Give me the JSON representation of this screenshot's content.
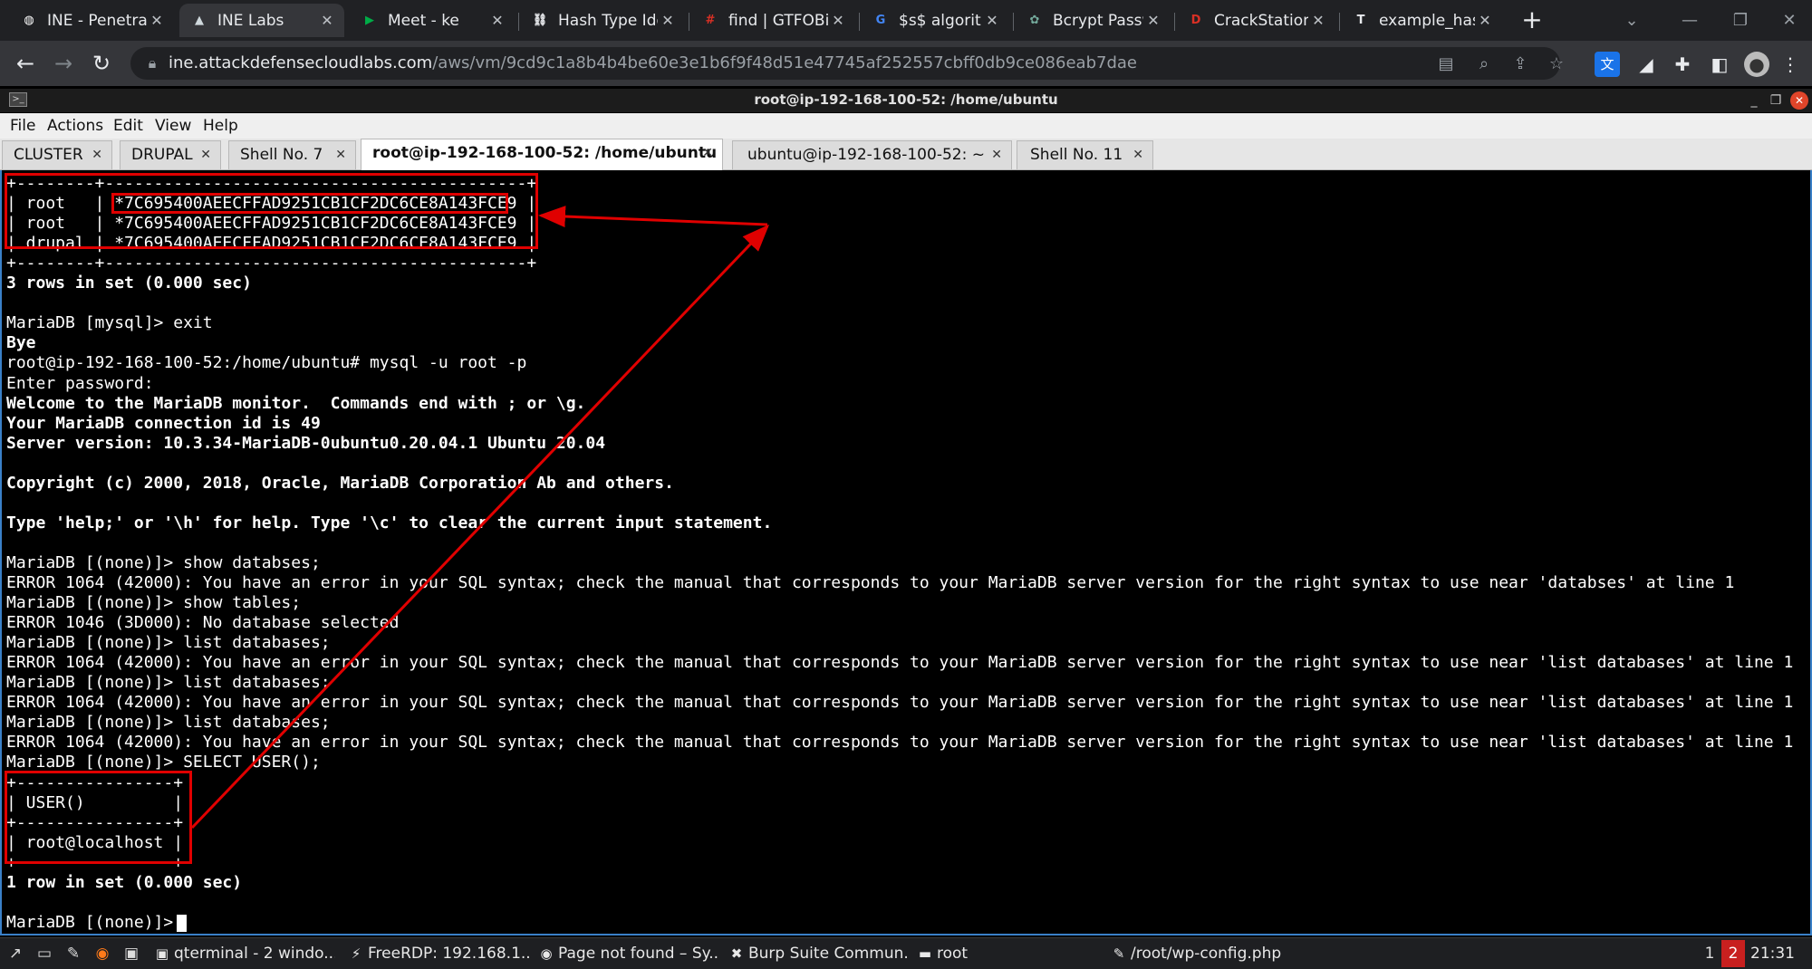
{
  "browser": {
    "tabs": [
      {
        "title": "INE - Penetrati",
        "icon": "ine-icon",
        "icon_color": "#ffffff",
        "glyph": "◍"
      },
      {
        "title": "INE Labs",
        "icon": "ine-labs-icon",
        "icon_color": "#cfd8dc",
        "glyph": "▲"
      },
      {
        "title": "Meet - ke",
        "icon": "google-meet-icon",
        "icon_color": "#00ac47",
        "glyph": "▶"
      },
      {
        "title": "Hash Type Ide",
        "icon": "hash-type-icon",
        "icon_color": "#e8eaed",
        "glyph": "⛓"
      },
      {
        "title": "find | GTFOBin",
        "icon": "gtfobins-icon",
        "icon_color": "#d93025",
        "glyph": "#"
      },
      {
        "title": "$s$ algorithm",
        "icon": "google-icon",
        "icon_color": "#4285f4",
        "glyph": "G"
      },
      {
        "title": "Bcrypt Passwo",
        "icon": "chatgpt-icon",
        "icon_color": "#74aa9c",
        "glyph": "✿"
      },
      {
        "title": "CrackStation -",
        "icon": "crackstation-icon",
        "icon_color": "#d93025",
        "glyph": "D"
      },
      {
        "title": "example_hash",
        "icon": "hashcat-icon",
        "icon_color": "#e8eaed",
        "glyph": "T"
      }
    ],
    "url_host": "ine.attackdefensecloudlabs.com",
    "url_path": "/aws/vm/9cd9c1a8b4b4be60e3e1b6f9f48d51e47745af252557cbff0db9ce086eab7dae"
  },
  "window": {
    "title": "root@ip-192-168-100-52: /home/ubuntu"
  },
  "menu": [
    "File",
    "Actions",
    "Edit",
    "View",
    "Help"
  ],
  "terminal_tabs": [
    {
      "label": "CLUSTER"
    },
    {
      "label": "DRUPAL"
    },
    {
      "label": "Shell No. 7"
    },
    {
      "label": "root@ip-192-168-100-52: /home/ubuntu"
    },
    {
      "label": "ubuntu@ip-192-168-100-52: ~"
    },
    {
      "label": "Shell No. 11"
    }
  ],
  "terminal": {
    "lines": [
      {
        "text": "+--------+-------------------------------------------+",
        "bold": false
      },
      {
        "text": "| root   | *7C695400AEECFFAD9251CB1CF2DC6CE8A143FCE9 |",
        "bold": false
      },
      {
        "text": "| root   | *7C695400AEECFFAD9251CB1CF2DC6CE8A143FCE9 |",
        "bold": false
      },
      {
        "text": "| drupal | *7C695400AEECFFAD9251CB1CF2DC6CE8A143FCE9 |",
        "bold": false
      },
      {
        "text": "+--------+-------------------------------------------+",
        "bold": false
      },
      {
        "text": "3 rows in set (0.000 sec)",
        "bold": true
      },
      {
        "text": "",
        "bold": false
      },
      {
        "text": "MariaDB [mysql]> exit",
        "bold": false
      },
      {
        "text": "Bye",
        "bold": true
      },
      {
        "text": "root@ip-192-168-100-52:/home/ubuntu# mysql -u root -p",
        "bold": false
      },
      {
        "text": "Enter password:",
        "bold": false
      },
      {
        "text": "Welcome to the MariaDB monitor.  Commands end with ; or \\g.",
        "bold": true
      },
      {
        "text": "Your MariaDB connection id is 49",
        "bold": true
      },
      {
        "text": "Server version: 10.3.34-MariaDB-0ubuntu0.20.04.1 Ubuntu 20.04",
        "bold": true
      },
      {
        "text": "",
        "bold": false
      },
      {
        "text": "Copyright (c) 2000, 2018, Oracle, MariaDB Corporation Ab and others.",
        "bold": true
      },
      {
        "text": "",
        "bold": false
      },
      {
        "text": "Type 'help;' or '\\h' for help. Type '\\c' to clear the current input statement.",
        "bold": true
      },
      {
        "text": "",
        "bold": false
      },
      {
        "text": "MariaDB [(none)]> show databses;",
        "bold": false
      },
      {
        "text": "ERROR 1064 (42000): You have an error in your SQL syntax; check the manual that corresponds to your MariaDB server version for the right syntax to use near 'databses' at line 1",
        "bold": false
      },
      {
        "text": "MariaDB [(none)]> show tables;",
        "bold": false
      },
      {
        "text": "ERROR 1046 (3D000): No database selected",
        "bold": false
      },
      {
        "text": "MariaDB [(none)]> list databases;",
        "bold": false
      },
      {
        "text": "ERROR 1064 (42000): You have an error in your SQL syntax; check the manual that corresponds to your MariaDB server version for the right syntax to use near 'list databases' at line 1",
        "bold": false
      },
      {
        "text": "MariaDB [(none)]> list databases;",
        "bold": false
      },
      {
        "text": "ERROR 1064 (42000): You have an error in your SQL syntax; check the manual that corresponds to your MariaDB server version for the right syntax to use near 'list databases' at line 1",
        "bold": false
      },
      {
        "text": "MariaDB [(none)]> list databases;",
        "bold": false
      },
      {
        "text": "ERROR 1064 (42000): You have an error in your SQL syntax; check the manual that corresponds to your MariaDB server version for the right syntax to use near 'list databases' at line 1",
        "bold": false
      },
      {
        "text": "MariaDB [(none)]> SELECT USER();",
        "bold": false
      },
      {
        "text": "+----------------+",
        "bold": false
      },
      {
        "text": "| USER()         |",
        "bold": false
      },
      {
        "text": "+----------------+",
        "bold": false
      },
      {
        "text": "| root@localhost |",
        "bold": false
      },
      {
        "text": "+----------------+",
        "bold": false
      },
      {
        "text": "1 row in set (0.000 sec)",
        "bold": true
      },
      {
        "text": "",
        "bold": false
      },
      {
        "text": "MariaDB [(none)]> ",
        "bold": false
      }
    ]
  },
  "taskbar": {
    "items": [
      {
        "label": "qterminal - 2 windo...",
        "icon": "terminal-icon",
        "glyph": "▣"
      },
      {
        "label": "FreeRDP: 192.168.1...",
        "icon": "freerdp-icon",
        "glyph": "⚡"
      },
      {
        "label": "Page not found – Sy...",
        "icon": "firefox-icon",
        "glyph": "◉"
      },
      {
        "label": "Burp Suite Commun...",
        "icon": "burp-icon",
        "glyph": "✖"
      },
      {
        "label": "root",
        "icon": "folder-icon",
        "glyph": "▬"
      },
      {
        "label": "/root/wp-config.php",
        "icon": "text-editor-icon",
        "glyph": "✎"
      }
    ],
    "workspaces": [
      "1",
      "2"
    ],
    "active_workspace": "2",
    "clock": "21:31"
  },
  "colors": {
    "annotation": "#e00000",
    "chrome_dark": "#202124",
    "terminal_bg": "#000000"
  }
}
